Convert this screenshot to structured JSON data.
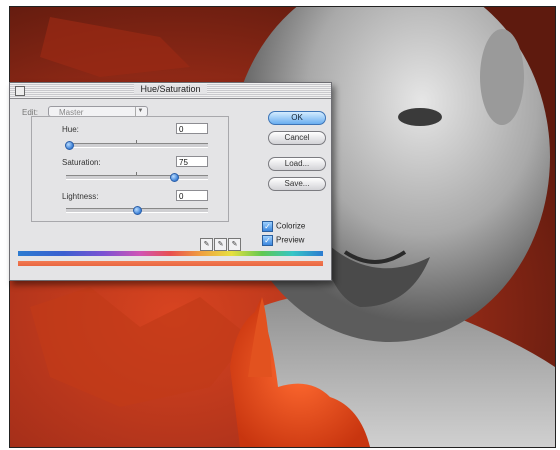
{
  "dialog": {
    "title": "Hue/Saturation",
    "edit_label": "Edit:",
    "edit_value": "Master"
  },
  "adjustments": {
    "hue_label": "Hue:",
    "hue_value": "0",
    "saturation_label": "Saturation:",
    "saturation_value": "75",
    "lightness_label": "Lightness:",
    "lightness_value": "0"
  },
  "buttons": {
    "ok": "OK",
    "cancel": "Cancel",
    "load": "Load...",
    "save": "Save..."
  },
  "options": {
    "colorize_label": "Colorize",
    "colorize_checked": true,
    "preview_label": "Preview",
    "preview_checked": true
  },
  "icons": {
    "eyedropper": "eyedropper-icon",
    "eyedropper_plus": "eyedropper-plus-icon",
    "eyedropper_minus": "eyedropper-minus-icon",
    "check": "checkmark-icon",
    "close": "close-box-icon"
  },
  "slider_levels": {
    "hue": 0.0,
    "saturation": 0.75,
    "lightness": 0.5
  },
  "colors": {
    "colorize_tint": "#e55a32",
    "accent": "#3b7fd6"
  }
}
